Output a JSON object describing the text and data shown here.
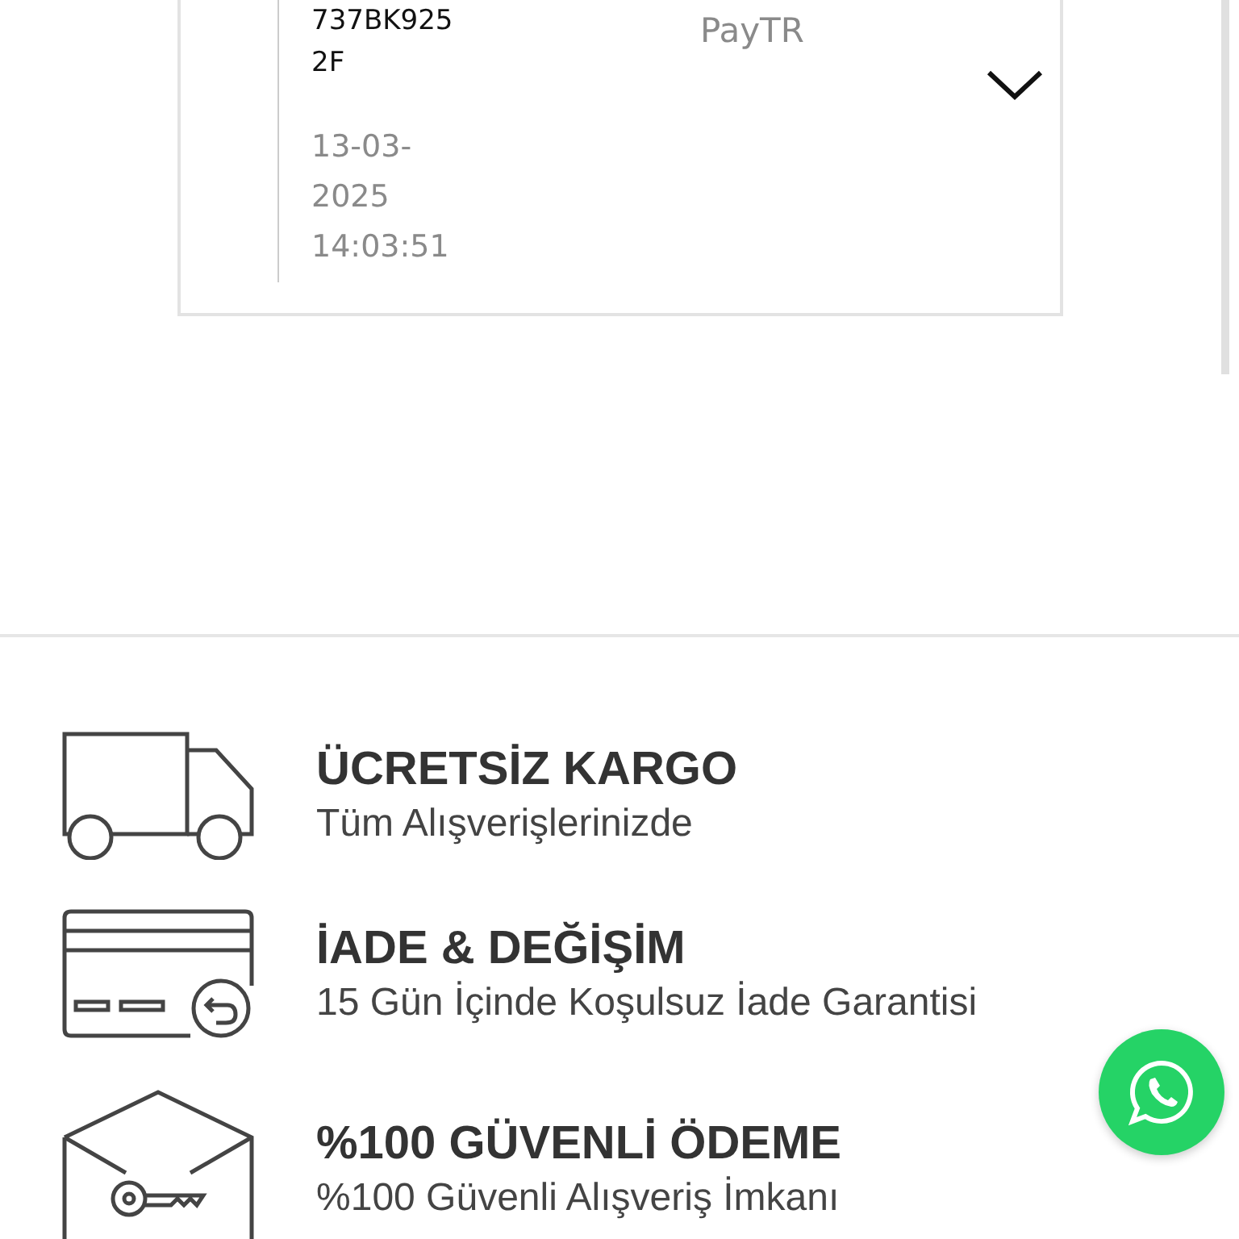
{
  "order": {
    "code_lines": [
      "737BK925",
      "2F"
    ],
    "datetime": "13-03-2025 14:03:51",
    "payment": "PayTR",
    "expanded": false
  },
  "features": [
    {
      "kind": "truck",
      "title": "ÜCRETSİZ KARGO",
      "subtitle": "Tüm Alışverişlerinizde"
    },
    {
      "kind": "card",
      "title": "İADE & DEĞİŞİM",
      "subtitle": "15 Gün İçinde Koşulsuz İade Garantisi"
    },
    {
      "kind": "box",
      "title": "%100 GÜVENLİ ÖDEME",
      "subtitle": "%100 Güvenli Alışveriş İmkanı"
    }
  ]
}
